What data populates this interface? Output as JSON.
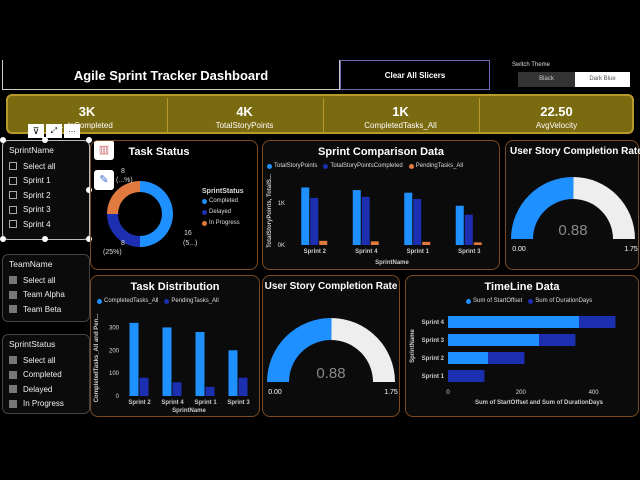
{
  "header": {
    "title": "Agile Sprint Tracker Dashboard",
    "clear_button": "Clear All Slicers",
    "switch_label": "Switch Theme",
    "theme_dark": "Black",
    "theme_light": "Dark Blue"
  },
  "kpis": [
    {
      "value": "3K",
      "label": "...tsCompleted"
    },
    {
      "value": "4K",
      "label": "TotalStoryPoints"
    },
    {
      "value": "1K",
      "label": "CompletedTasks_All"
    },
    {
      "value": "22.50",
      "label": "AvgVelocity"
    }
  ],
  "slicers": {
    "sprint": {
      "title": "SprintName",
      "options": [
        "Select all",
        "Sprint 1",
        "Sprint 2",
        "Sprint 3",
        "Sprint 4"
      ]
    },
    "team": {
      "title": "TeamName",
      "options": [
        "Select all",
        "Team Alpha",
        "Team Beta"
      ]
    },
    "status": {
      "title": "SprintStatus",
      "options": [
        "Select all",
        "Completed",
        "Delayed",
        "In Progress"
      ]
    }
  },
  "task_status": {
    "title": "Task Status",
    "legend_title": "SprintStatus",
    "legend": [
      "Completed",
      "Delayed",
      "In Progress"
    ],
    "label_top": "8",
    "label_top2": "(...%)",
    "label_bottom": "8",
    "label_bottom2": "(25%)",
    "label_right": "16",
    "label_right2": "(5...)",
    "colors": [
      "#1e90ff",
      "#1c2fb0",
      "#e07a3f"
    ]
  },
  "sprint_comparison": {
    "title": "Sprint Comparison Data",
    "legend": [
      "TotalStoryPoints",
      "TotalStoryPointsCompleted",
      "PendingTasks_All"
    ],
    "ylabel": "TotalStoryPoints, TotalS...",
    "xlabel": "SprintName",
    "yticks": [
      "1K",
      "0K"
    ]
  },
  "completion1": {
    "title": "User Story Completion Rate",
    "value": "0.88",
    "min": "0.00",
    "max": "1.75"
  },
  "completion2": {
    "title": "User Story Completion Rate",
    "value": "0.88",
    "min": "0.00",
    "max": "1.75"
  },
  "task_distribution": {
    "title": "Task Distribution",
    "legend": [
      "CompletedTasks_All",
      "PendingTasks_All"
    ],
    "ylabel": "CompletedTasks_All and Pen...",
    "xlabel": "SprintName",
    "yticks": [
      "300",
      "200",
      "100",
      "0"
    ]
  },
  "timeline": {
    "title": "TimeLine Data",
    "legend": [
      "Sum of StartOffset",
      "Sum of DurationDays"
    ],
    "ylabel": "SprintName",
    "xlabel": "Sum of StartOffset and Sum of DurationDays",
    "xticks": [
      "0",
      "200",
      "400"
    ]
  },
  "chart_data": [
    {
      "type": "pie",
      "title": "Task Status",
      "categories": [
        "Completed",
        "Delayed",
        "In Progress"
      ],
      "values": [
        16,
        8,
        8
      ]
    },
    {
      "type": "bar",
      "title": "Sprint Comparison Data",
      "categories": [
        "Sprint 2",
        "Sprint 4",
        "Sprint 1",
        "Sprint 3"
      ],
      "series": [
        {
          "name": "TotalStoryPoints",
          "values": [
            1100,
            1050,
            1000,
            750
          ]
        },
        {
          "name": "TotalStoryPointsCompleted",
          "values": [
            900,
            920,
            880,
            580
          ]
        },
        {
          "name": "PendingTasks_All",
          "values": [
            80,
            70,
            60,
            50
          ]
        }
      ],
      "xlabel": "SprintName",
      "ylabel": "TotalStoryPoints, TotalS...",
      "ylim": [
        0,
        1300
      ]
    },
    {
      "type": "bar",
      "title": "Task Distribution",
      "categories": [
        "Sprint 2",
        "Sprint 4",
        "Sprint 1",
        "Sprint 3"
      ],
      "series": [
        {
          "name": "CompletedTasks_All",
          "values": [
            320,
            300,
            280,
            200
          ]
        },
        {
          "name": "PendingTasks_All",
          "values": [
            80,
            60,
            40,
            80
          ]
        }
      ],
      "xlabel": "SprintName",
      "ylabel": "CompletedTasks_All and Pen...",
      "ylim": [
        0,
        350
      ]
    },
    {
      "type": "bar",
      "title": "TimeLine Data",
      "categories": [
        "Sprint 4",
        "Sprint 3",
        "Sprint 2",
        "Sprint 1"
      ],
      "series": [
        {
          "name": "Sum of StartOffset",
          "values": [
            360,
            250,
            110,
            0
          ]
        },
        {
          "name": "Sum of DurationDays",
          "values": [
            100,
            100,
            100,
            100
          ]
        }
      ],
      "xlabel": "Sum of StartOffset and Sum of DurationDays",
      "ylabel": "SprintName",
      "xlim": [
        0,
        500
      ]
    }
  ]
}
